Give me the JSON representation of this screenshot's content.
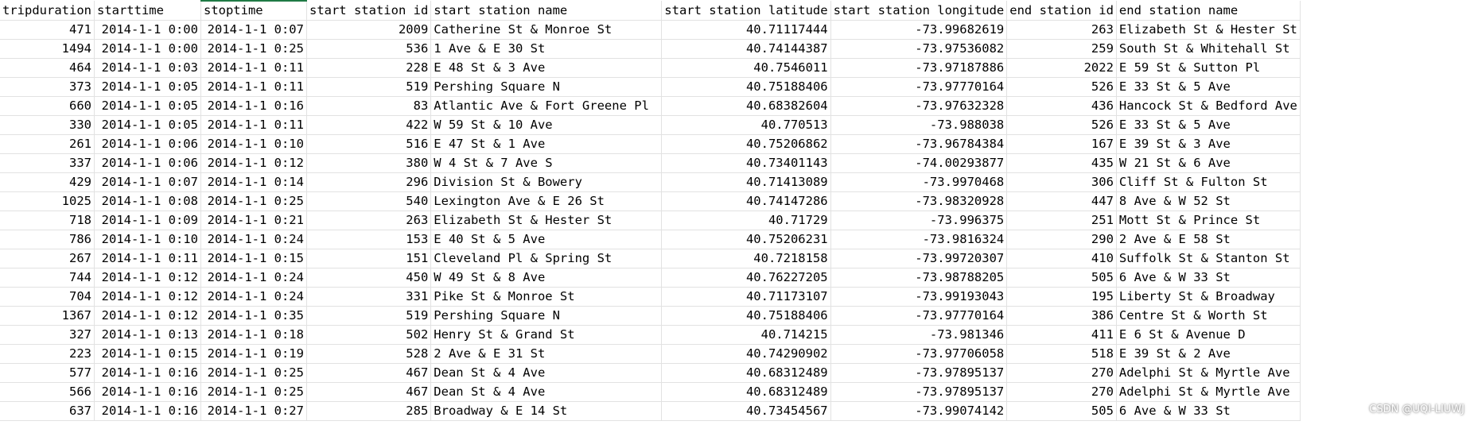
{
  "columns": [
    "tripduration",
    "starttime",
    "stoptime",
    "start station id",
    "start station name",
    "start station latitude",
    "start station longitude",
    "end station id",
    "end station name"
  ],
  "rows": [
    [
      "471",
      "2014-1-1 0:00",
      "2014-1-1 0:07",
      "2009",
      "Catherine St & Monroe St",
      "40.71117444",
      "-73.99682619",
      "263",
      "Elizabeth St & Hester St"
    ],
    [
      "1494",
      "2014-1-1 0:00",
      "2014-1-1 0:25",
      "536",
      "1 Ave & E 30 St",
      "40.74144387",
      "-73.97536082",
      "259",
      "South St & Whitehall St"
    ],
    [
      "464",
      "2014-1-1 0:03",
      "2014-1-1 0:11",
      "228",
      "E 48 St & 3 Ave",
      "40.7546011",
      "-73.97187886",
      "2022",
      "E 59 St & Sutton Pl"
    ],
    [
      "373",
      "2014-1-1 0:05",
      "2014-1-1 0:11",
      "519",
      "Pershing Square N",
      "40.75188406",
      "-73.97770164",
      "526",
      "E 33 St & 5 Ave"
    ],
    [
      "660",
      "2014-1-1 0:05",
      "2014-1-1 0:16",
      "83",
      "Atlantic Ave & Fort Greene Pl",
      "40.68382604",
      "-73.97632328",
      "436",
      "Hancock St & Bedford Ave"
    ],
    [
      "330",
      "2014-1-1 0:05",
      "2014-1-1 0:11",
      "422",
      "W 59 St & 10 Ave",
      "40.770513",
      "-73.988038",
      "526",
      "E 33 St & 5 Ave"
    ],
    [
      "261",
      "2014-1-1 0:06",
      "2014-1-1 0:10",
      "516",
      "E 47 St & 1 Ave",
      "40.75206862",
      "-73.96784384",
      "167",
      "E 39 St & 3 Ave"
    ],
    [
      "337",
      "2014-1-1 0:06",
      "2014-1-1 0:12",
      "380",
      "W 4 St & 7 Ave S",
      "40.73401143",
      "-74.00293877",
      "435",
      "W 21 St & 6 Ave"
    ],
    [
      "429",
      "2014-1-1 0:07",
      "2014-1-1 0:14",
      "296",
      "Division St & Bowery",
      "40.71413089",
      "-73.9970468",
      "306",
      "Cliff St & Fulton St"
    ],
    [
      "1025",
      "2014-1-1 0:08",
      "2014-1-1 0:25",
      "540",
      "Lexington Ave & E 26 St",
      "40.74147286",
      "-73.98320928",
      "447",
      "8 Ave & W 52 St"
    ],
    [
      "718",
      "2014-1-1 0:09",
      "2014-1-1 0:21",
      "263",
      "Elizabeth St & Hester St",
      "40.71729",
      "-73.996375",
      "251",
      "Mott St & Prince St"
    ],
    [
      "786",
      "2014-1-1 0:10",
      "2014-1-1 0:24",
      "153",
      "E 40 St & 5 Ave",
      "40.75206231",
      "-73.9816324",
      "290",
      "2 Ave & E 58 St"
    ],
    [
      "267",
      "2014-1-1 0:11",
      "2014-1-1 0:15",
      "151",
      "Cleveland Pl & Spring St",
      "40.7218158",
      "-73.99720307",
      "410",
      "Suffolk St & Stanton St"
    ],
    [
      "744",
      "2014-1-1 0:12",
      "2014-1-1 0:24",
      "450",
      "W 49 St & 8 Ave",
      "40.76227205",
      "-73.98788205",
      "505",
      "6 Ave & W 33 St"
    ],
    [
      "704",
      "2014-1-1 0:12",
      "2014-1-1 0:24",
      "331",
      "Pike St & Monroe St",
      "40.71173107",
      "-73.99193043",
      "195",
      "Liberty St & Broadway"
    ],
    [
      "1367",
      "2014-1-1 0:12",
      "2014-1-1 0:35",
      "519",
      "Pershing Square N",
      "40.75188406",
      "-73.97770164",
      "386",
      "Centre St & Worth St"
    ],
    [
      "327",
      "2014-1-1 0:13",
      "2014-1-1 0:18",
      "502",
      "Henry St & Grand St",
      "40.714215",
      "-73.981346",
      "411",
      "E 6 St & Avenue D"
    ],
    [
      "223",
      "2014-1-1 0:15",
      "2014-1-1 0:19",
      "528",
      "2 Ave & E 31 St",
      "40.74290902",
      "-73.97706058",
      "518",
      "E 39 St & 2 Ave"
    ],
    [
      "577",
      "2014-1-1 0:16",
      "2014-1-1 0:25",
      "467",
      "Dean St & 4 Ave",
      "40.68312489",
      "-73.97895137",
      "270",
      "Adelphi St & Myrtle Ave"
    ],
    [
      "566",
      "2014-1-1 0:16",
      "2014-1-1 0:25",
      "467",
      "Dean St & 4 Ave",
      "40.68312489",
      "-73.97895137",
      "270",
      "Adelphi St & Myrtle Ave"
    ],
    [
      "637",
      "2014-1-1 0:16",
      "2014-1-1 0:27",
      "285",
      "Broadway & E 14 St",
      "40.73454567",
      "-73.99074142",
      "505",
      "6 Ave & W 33 St"
    ]
  ],
  "column_align": [
    "num",
    "num",
    "num",
    "num",
    "txt",
    "num",
    "num",
    "num",
    "txt"
  ],
  "watermark": "CSDN @UQI-LIUWJ",
  "colors": {
    "grid_line": "#e2e2e2",
    "selection_accent": "#1f7a45"
  }
}
